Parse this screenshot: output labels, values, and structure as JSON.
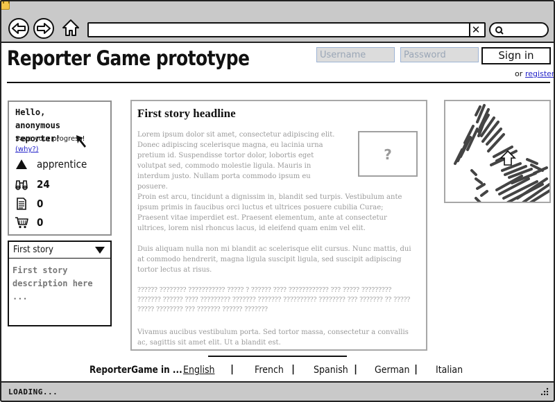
{
  "browser": {
    "status": "LOADING..."
  },
  "header": {
    "title": "Reporter Game prototype",
    "username_placeholder": "Username",
    "password_placeholder": "Password",
    "signin_label": "Sign in",
    "or_text": "or",
    "register_label": "register"
  },
  "profile": {
    "greeting": "Hello, anonymous reporter!",
    "save_progress": "Save your progress!",
    "why_label": "(why?)",
    "rank": "apprentice",
    "stats": [
      {
        "icon": "binoculars-icon",
        "value": "24"
      },
      {
        "icon": "document-icon",
        "value": "0"
      },
      {
        "icon": "cart-icon",
        "value": "0"
      }
    ]
  },
  "story_panel": {
    "selected": "First story",
    "description": "First story description here ..."
  },
  "article": {
    "headline": "First story headline",
    "image_placeholder": "?",
    "paragraphs": [
      "Lorem ipsum dolor sit amet, consectetur adipiscing elit. Donec adipiscing scelerisque magna, eu lacinia urna pretium id. Suspendisse tortor dolor, lobortis eget volutpat sed, commodo molestie ligula. Mauris in interdum justo. Nullam porta commodo ipsum eu posuere.",
      "Proin est arcu, tincidunt a dignissim in, blandit sed turpis. Vestibulum ante ipsum primis in faucibus orci luctus et ultrices posuere cubilia Curae; Praesent vitae imperdiet est. Praesent elementum, ante at consectetur ultrices, lorem nisl rhoncus lacus, id eleifend quam enim vel elit.",
      "Duis aliquam nulla non mi blandit ac scelerisque elit cursus. Nunc mattis, dui at commodo hendrerit, magna ligula suscipit ligula, sed suscipit adipiscing tortor lectus at risus.",
      "?????? ???????? ??????????? ????? ? ?????? ???? ???????????? ??? ????? ????????? ??????? ?????? ???? ????????? ??????? ??????? ?????????? ???????? ??? ??????? ?? ????? ????? ???????? ??? ??????? ?????? ???????",
      "Vivamus aucibus vestibulum porta. Sed tortor massa, consectetur a convallis ac, sagittis sit amet elit. Ut a blandit est."
    ]
  },
  "footer": {
    "lang_prefix": "ReporterGame in ...",
    "languages": [
      "English",
      "French",
      "Spanish",
      "German",
      "Italian"
    ],
    "separator": "|"
  }
}
